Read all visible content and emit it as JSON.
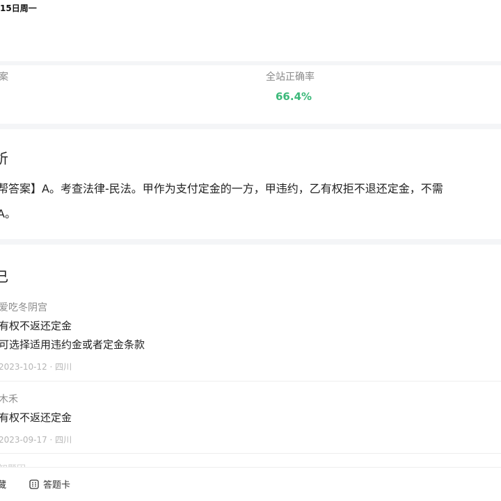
{
  "status_bar": {
    "time_text": "15日周一"
  },
  "stats": {
    "left_label": "案",
    "accuracy_label": "全站正确率",
    "accuracy_value": "66.4%"
  },
  "analysis": {
    "title": "析",
    "line1": "帮答案】A。考查法律-民法。甲作为支付定金的一方，甲违约，乙有权拒不退还定金，不需",
    "line2": "A。"
  },
  "notes": {
    "title": "己",
    "items": [
      {
        "author": "爱吃冬阴宫",
        "lines": [
          "有权不返还定金",
          "可选择适用违约金或者定金条款"
        ],
        "meta": "2023-10-12 · 四川"
      },
      {
        "author": "木禾",
        "lines": [
          "有权不返还定金"
        ],
        "meta": "2023-09-17 · 四川"
      }
    ],
    "partial_author": "知题因"
  },
  "bottom_bar": {
    "collect_label": "藏",
    "answer_card_label": "答题卡"
  }
}
